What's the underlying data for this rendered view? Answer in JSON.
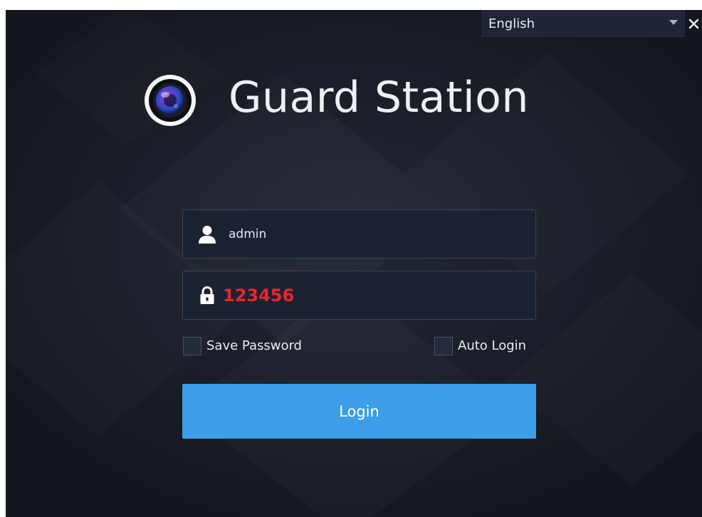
{
  "language": {
    "selected": "English"
  },
  "app": {
    "title": "Guard Station"
  },
  "login_form": {
    "username_value": "admin",
    "password_value": "123456",
    "save_password_label": "Save Password",
    "save_password_checked": false,
    "auto_login_label": "Auto Login",
    "auto_login_checked": false,
    "login_button_label": "Login"
  },
  "colors": {
    "background": "#181a22",
    "field_background": "#1b2333",
    "login_button": "#3d9de6",
    "password_text": "#e8262c"
  }
}
